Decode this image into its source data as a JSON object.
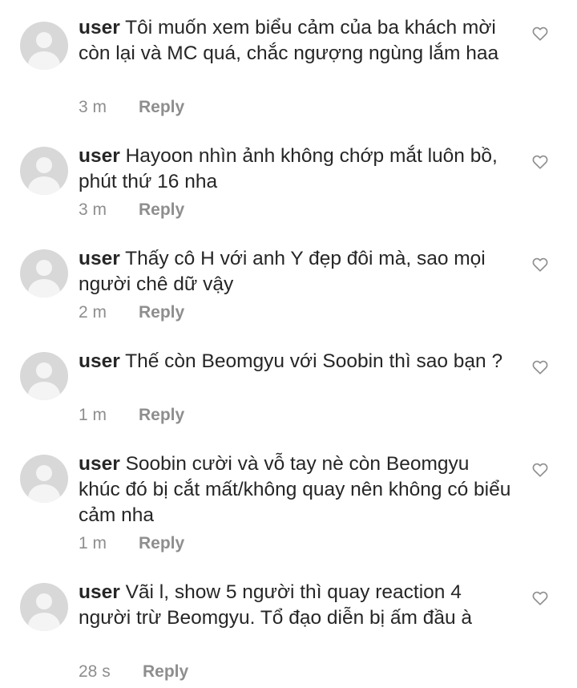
{
  "comments": [
    {
      "username": "user",
      "text": "Tôi muốn xem biểu cảm của ba khách mời còn lại và MC quá, chắc ngượng ngùng lắm haa",
      "time": "3 m",
      "reply_label": "Reply"
    },
    {
      "username": "user",
      "text": "Hayoon nhìn ảnh không chớp mắt luôn bồ, phút thứ 16 nha",
      "time": "3 m",
      "reply_label": "Reply"
    },
    {
      "username": "user",
      "text": "Thấy cô H với anh Y đẹp đôi mà, sao mọi người chê dữ vậy",
      "time": "2 m",
      "reply_label": "Reply"
    },
    {
      "username": "user",
      "text": "Thế còn Beomgyu với Soobin thì sao bạn ?",
      "time": "1 m",
      "reply_label": "Reply"
    },
    {
      "username": "user",
      "text": "Soobin cười và vỗ tay nè còn Beomgyu khúc đó bị cắt mất/không quay nên không có biểu cảm nha",
      "time": "1 m",
      "reply_label": "Reply"
    },
    {
      "username": "user",
      "text": "Vãi l, show 5 người thì quay reaction 4 người trừ Beomgyu. Tổ đạo diễn bị ấm đầu à",
      "time": "28 s",
      "reply_label": "Reply"
    }
  ],
  "icons": {
    "avatar": "default-user-avatar",
    "like": "heart-outline-icon"
  },
  "colors": {
    "text": "#262626",
    "muted": "#8e8e8e",
    "avatar_bg": "#d8d8d8",
    "avatar_fg": "#f4f4f4"
  }
}
